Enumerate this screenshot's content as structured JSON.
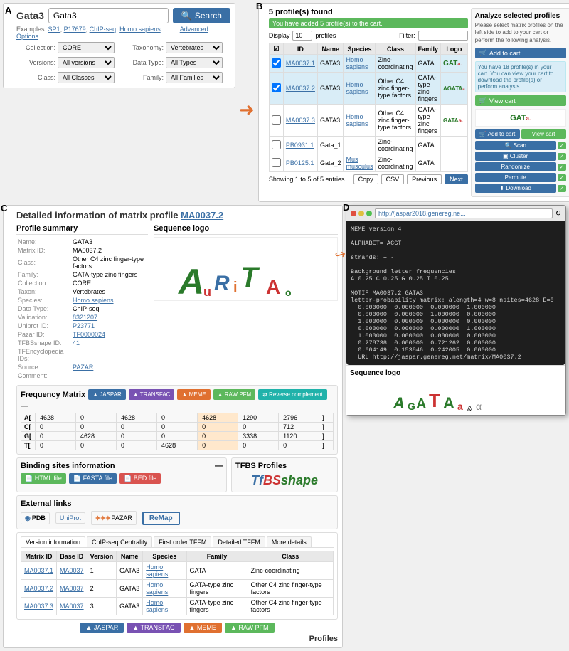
{
  "sections": {
    "a": {
      "label": "A",
      "title": "Gata3",
      "search_placeholder": "Gata3",
      "search_btn": "Search",
      "examples_label": "Examples:",
      "examples": [
        "SP1",
        "P17679",
        "ChIP-seq",
        "Homo sapiens"
      ],
      "advanced_label": "Advanced Options",
      "form": {
        "collection_label": "Collection:",
        "collection_value": "CORE",
        "taxonomy_label": "Taxonomy:",
        "taxonomy_value": "Vertebrates",
        "versions_label": "Versions:",
        "versions_value": "All versions",
        "data_type_label": "Data Type:",
        "data_type_value": "All Types",
        "class_label": "Class:",
        "class_value": "All Classes",
        "family_label": "Family:",
        "family_value": "All Families"
      }
    },
    "b": {
      "label": "B",
      "found_text": "5 profile(s) found",
      "banner_text": "You have added 5 profile(s) to the cart.",
      "display_label": "Display",
      "display_value": "10",
      "profiles_label": "profiles",
      "filter_label": "Filter:",
      "columns": [
        "ID",
        "Name",
        "Species",
        "Class",
        "Family",
        "Logo"
      ],
      "rows": [
        {
          "id": "MA0037.1",
          "name": "GATA3",
          "species": "Homo sapiens",
          "class": "Zinc-coordinating",
          "family": "GATA",
          "logo": "GATa.",
          "selected": true
        },
        {
          "id": "MA0037.2",
          "name": "GATA3",
          "species": "Homo sapiens",
          "class": "Other C4 zinc finger-type factors",
          "family": "GATA-type zinc fingers",
          "logo": "AGATAa",
          "selected": true
        },
        {
          "id": "MA0037.3",
          "name": "GATA3",
          "species": "Homo sapiens",
          "class": "Other C4 zinc finger-type factors",
          "family": "GATA-type zinc fingers",
          "logo": "GATAa.",
          "selected": false
        },
        {
          "id": "PB0931.1",
          "name": "Gata_1",
          "species": "",
          "class": "Zinc-coordinating",
          "family": "GATA",
          "logo": "",
          "selected": false
        },
        {
          "id": "PB0125.1",
          "name": "Gata_2",
          "species": "Mus musculus",
          "class": "Zinc-coordinating",
          "family": "GATA",
          "logo": "",
          "selected": false
        }
      ],
      "showing_text": "Showing 1 to 5 of 5 entries",
      "copy_btn": "Copy",
      "csv_btn": "CSV",
      "prev_btn": "Previous",
      "next_btn": "Next",
      "analyze_title": "Analyze selected profiles",
      "analyze_desc": "Please select matrix profiles on the left side to add to your cart or perform the following analysis.",
      "add_to_cart_btn": "Add to cart",
      "info_box_text": "You have 18 profile(s) in your cart. You can view your cart to download the profile(s) or perform analysis.",
      "view_cart_btn": "View cart",
      "scan_btn": "Scan",
      "cluster_btn": "Cluster",
      "randomize_btn": "Randomize",
      "permute_btn": "Permute",
      "download_btn": "Download"
    },
    "c": {
      "label": "C",
      "title_prefix": "Detailed information of matrix profile",
      "title_id": "MA0037.2",
      "profile_summary": {
        "title": "Profile summary",
        "fields": [
          {
            "label": "Name:",
            "value": "GATA3",
            "link": false
          },
          {
            "label": "Matrix ID:",
            "value": "MA0037.2",
            "link": false
          },
          {
            "label": "Class:",
            "value": "Other C4 zinc finger-type factors",
            "link": false
          },
          {
            "label": "Family:",
            "value": "GATA-type zinc fingers",
            "link": false
          },
          {
            "label": "Collection:",
            "value": "CORE",
            "link": false
          },
          {
            "label": "Taxon:",
            "value": "Vertebrates",
            "link": false
          },
          {
            "label": "Species:",
            "value": "Homo sapiens",
            "link": true
          },
          {
            "label": "Data Type:",
            "value": "ChIP-seq",
            "link": false
          },
          {
            "label": "Validation:",
            "value": "8321207",
            "link": true
          },
          {
            "label": "Uniprot ID:",
            "value": "P23771",
            "link": true
          },
          {
            "label": "Pazar ID:",
            "value": "TF0000024",
            "link": true
          },
          {
            "label": "TFBSshape ID:",
            "value": "41",
            "link": true
          },
          {
            "label": "TFEncyclopedia IDs:",
            "value": "",
            "link": false
          },
          {
            "label": "Source:",
            "value": "PAZAR",
            "link": true
          },
          {
            "label": "Comment:",
            "value": "",
            "link": false
          }
        ]
      },
      "seq_logo": {
        "title": "Sequence logo",
        "logo_text": "AuRiTAo"
      },
      "frequency_matrix": {
        "title": "Frequency Matrix",
        "buttons": [
          "JASPAR",
          "TRANSFAC",
          "MEME",
          "RAW PFM",
          "Reverse complement"
        ],
        "rows": [
          {
            "base": "A[",
            "values": [
              4628,
              0,
              4628,
              0,
              4628,
              1290,
              2796
            ],
            "suffix": "]"
          },
          {
            "base": "C[",
            "values": [
              0,
              0,
              0,
              0,
              0,
              0,
              712
            ],
            "suffix": "]"
          },
          {
            "base": "G[",
            "values": [
              0,
              4628,
              0,
              0,
              0,
              3338,
              1120
            ],
            "suffix": "]"
          },
          {
            "base": "T[",
            "values": [
              0,
              0,
              0,
              4628,
              0,
              0,
              0
            ],
            "suffix": "]"
          }
        ]
      },
      "binding_sites": {
        "title": "Binding sites information",
        "minus_btn": "-",
        "html_btn": "HTML file",
        "fasta_btn": "FASTA file",
        "bed_btn": "BED file"
      },
      "tfbs_profiles": {
        "title": "TFBS Profiles",
        "logo_text": "TfBSshape"
      },
      "external_links": {
        "title": "External links",
        "logos": [
          "PDB",
          "UniProt",
          "PAZAR",
          "ReMap"
        ]
      },
      "version_tabs": [
        "Version information",
        "ChIP-seq Centrality",
        "First order TFFM",
        "Detailed TFFM",
        "More details"
      ],
      "version_table": {
        "columns": [
          "Matrix ID",
          "Base ID",
          "Version",
          "Name",
          "Species",
          "Family",
          "Class"
        ],
        "rows": [
          {
            "matrix_id": "MA0037.1",
            "base_id": "MA0037",
            "version": "1",
            "name": "GATA3",
            "species": "Homo sapiens",
            "family": "GATA",
            "class": "Zinc-coordinating"
          },
          {
            "matrix_id": "MA0037.2",
            "base_id": "MA0037",
            "version": "2",
            "name": "GATA3",
            "species": "Homo sapiens",
            "family": "GATA-type zinc fingers",
            "class": "Other C4 zinc finger-type factors"
          },
          {
            "matrix_id": "MA0037.3",
            "base_id": "MA0037",
            "version": "3",
            "name": "GATA3",
            "species": "Homo sapiens",
            "family": "GATA-type zinc fingers",
            "class": "Other C4 zinc finger-type factors"
          }
        ]
      },
      "bottom_buttons": [
        "JASPAR",
        "TRANSFAC",
        "MEME",
        "RAW PFM"
      ],
      "profiles_label": "Profiles"
    },
    "d": {
      "label": "D",
      "url": "http://jaspar2018.genereg.ne...",
      "code_lines": [
        "MEME version 4",
        "",
        "ALPHABET= ACGT",
        "",
        "strands: + -",
        "",
        "Background letter frequencies",
        "A 0.25 C 0.25 G 0.25 T 0.25",
        "",
        "MOTIF MA0037.2 GATA3",
        "letter-probability matrix: alength=4 w=8 nsites=4628 E=0",
        "  0.000000  0.000000  0.000000  1.000000",
        "  0.000000  0.000000  1.000000  0.000000",
        "  1.000000  0.000000  0.000000  0.000000",
        "  0.000000  0.000000  0.000000  1.000000",
        "  1.000000  0.000000  0.000000  0.000000",
        "  0.278738  0.000000  0.721262  0.000000",
        "  0.604149  0.153846  0.242005  0.000000",
        "  URL http://jaspar.genereg.net/matrix/MA0037.2"
      ],
      "seq_logo_title": "Sequence logo",
      "seq_logo_text": "AGATAa&α"
    }
  }
}
